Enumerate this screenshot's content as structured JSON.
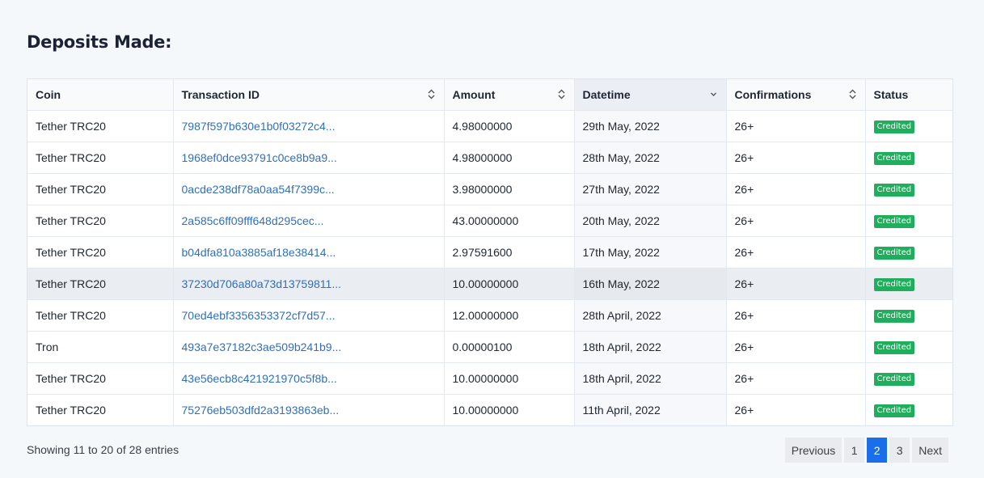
{
  "page": {
    "title": "Deposits Made:"
  },
  "table": {
    "headers": [
      "Coin",
      "Transaction ID",
      "Amount",
      "Datetime",
      "Confirmations",
      "Status"
    ],
    "sort_column": "Datetime",
    "rows": [
      {
        "coin": "Tether TRC20",
        "txid": "7987f597b630e1b0f03272c4...",
        "amount": "4.98000000",
        "datetime": "29th May, 2022",
        "confirmations": "26+",
        "status": "Credited"
      },
      {
        "coin": "Tether TRC20",
        "txid": "1968ef0dce93791c0ce8b9a9...",
        "amount": "4.98000000",
        "datetime": "28th May, 2022",
        "confirmations": "26+",
        "status": "Credited"
      },
      {
        "coin": "Tether TRC20",
        "txid": "0acde238df78a0aa54f7399c...",
        "amount": "3.98000000",
        "datetime": "27th May, 2022",
        "confirmations": "26+",
        "status": "Credited"
      },
      {
        "coin": "Tether TRC20",
        "txid": "2a585c6ff09fff648d295cec...",
        "amount": "43.00000000",
        "datetime": "20th May, 2022",
        "confirmations": "26+",
        "status": "Credited"
      },
      {
        "coin": "Tether TRC20",
        "txid": "b04dfa810a3885af18e38414...",
        "amount": "2.97591600",
        "datetime": "17th May, 2022",
        "confirmations": "26+",
        "status": "Credited"
      },
      {
        "coin": "Tether TRC20",
        "txid": "37230d706a80a73d13759811...",
        "amount": "10.00000000",
        "datetime": "16th May, 2022",
        "confirmations": "26+",
        "status": "Credited"
      },
      {
        "coin": "Tether TRC20",
        "txid": "70ed4ebf3356353372cf7d57...",
        "amount": "12.00000000",
        "datetime": "28th April, 2022",
        "confirmations": "26+",
        "status": "Credited"
      },
      {
        "coin": "Tron",
        "txid": "493a7e37182c3ae509b241b9...",
        "amount": "0.00000100",
        "datetime": "18th April, 2022",
        "confirmations": "26+",
        "status": "Credited"
      },
      {
        "coin": "Tether TRC20",
        "txid": "43e56ecb8c421921970c5f8b...",
        "amount": "10.00000000",
        "datetime": "18th April, 2022",
        "confirmations": "26+",
        "status": "Credited"
      },
      {
        "coin": "Tether TRC20",
        "txid": "75276eb503dfd2a3193863eb...",
        "amount": "10.00000000",
        "datetime": "11th April, 2022",
        "confirmations": "26+",
        "status": "Credited"
      }
    ]
  },
  "footer": {
    "entries_info": "Showing 11 to 20 of 28 entries",
    "pagination": {
      "previous": "Previous",
      "pages": [
        "1",
        "2",
        "3"
      ],
      "current": "2",
      "next": "Next"
    }
  },
  "colors": {
    "link": "#2f6fbe",
    "badge": "#1fae5b",
    "active_page": "#1a6eea"
  },
  "icons": {
    "sortable": "sort-both-icon",
    "sorted_desc": "chevron-down-icon"
  }
}
